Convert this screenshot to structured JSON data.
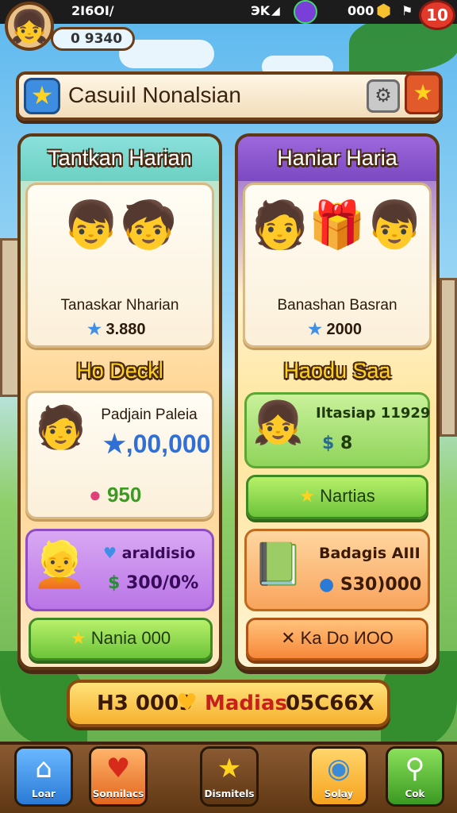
{
  "status_bar": {
    "time": "2I6OI/",
    "signal": "ЭK",
    "gem_count": "000",
    "notification_count": "10"
  },
  "player": {
    "coins": "9340",
    "coin_prefix": "0"
  },
  "header": {
    "title": "Casuiıl Nonalsian"
  },
  "left_panel": {
    "title": "Tantkan Harian",
    "top_card": {
      "name": "Tanaskar Nharian",
      "value": "3.880"
    },
    "section_title": "Ho Deckl",
    "offer_card": {
      "name": "Padjain Paleia",
      "value": ",00,000",
      "secondary": "950"
    },
    "purple_card": {
      "line1": "araldisio",
      "line2": "300/0%"
    },
    "button_label": "Nania 000"
  },
  "right_panel": {
    "title": "Haniar Haria",
    "top_card": {
      "name": "Banashan Basran",
      "value": "2000"
    },
    "section_title": "Haodu Saa",
    "green_card": {
      "name": "Iltasiap 11929",
      "value": "8"
    },
    "green_button_label": "Nartias",
    "orange_card": {
      "name": "Badagis AIII",
      "value": "S30)000"
    },
    "orange_button_label": "Ka Do ИOO"
  },
  "bottom_bar": {
    "left_text": "H3 0009",
    "middle_text": "Madias",
    "right_text": "05C66X"
  },
  "nav": [
    {
      "label": "Loar",
      "icon": "home-icon"
    },
    {
      "label": "Sonnilacs",
      "icon": "heart-icon"
    },
    {
      "label": "Dismitels",
      "icon": "star-icon"
    },
    {
      "label": "Solay",
      "icon": "fish-icon"
    },
    {
      "label": "Cok",
      "icon": "search-icon"
    }
  ],
  "colors": {
    "frame_brown": "#5e3713",
    "accent_green": "#6cc43a",
    "accent_orange": "#f6883a",
    "accent_purple": "#7b49c2",
    "accent_teal": "#6cd0c2"
  }
}
